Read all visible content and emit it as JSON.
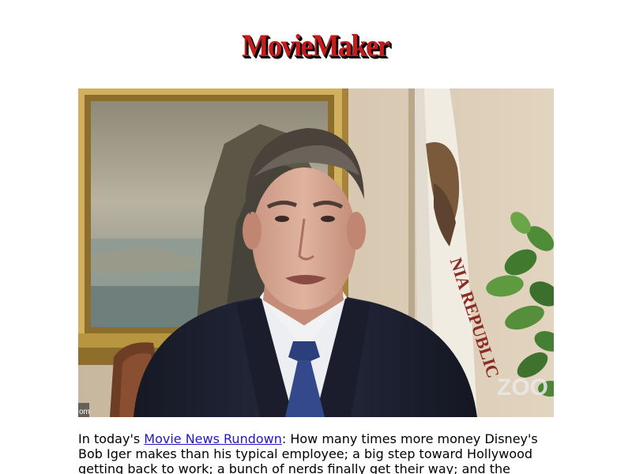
{
  "brand": {
    "logo_text": "MovieMaker"
  },
  "hero": {
    "watermark_text": "ZOO",
    "corner_text": "om"
  },
  "article": {
    "intro": "In today's ",
    "link_text": "Movie News Rundown",
    "body": ": How many times more money Disney's Bob Iger makes than his typical employee; a big step toward Hollywood getting back to work; a bunch of nerds finally get their way; and the"
  },
  "colors": {
    "logo_red": "#c41d1d",
    "link_blue": "#2216c9",
    "wall": "#d8c9b2",
    "frame_gold": "#b08f3a",
    "suit": "#1f2233",
    "tie": "#2b3f7d",
    "flag_red": "#b83a2e"
  }
}
